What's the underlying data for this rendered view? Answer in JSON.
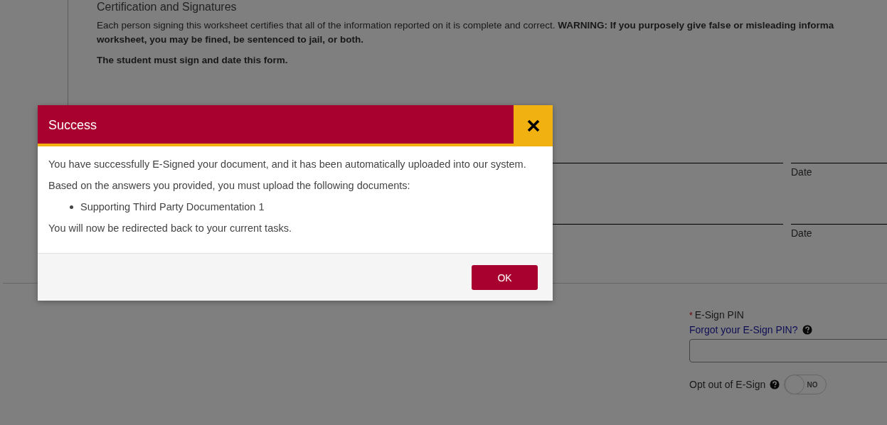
{
  "page": {
    "section_title": "Certification and Signatures",
    "certification_lines": [
      "Each person signing this worksheet certifies that all of the information reported on it is complete and correct. **WARNING: If you purposely give false or misleading informa**",
      "**worksheet, you may be fined, be sentenced to jail, or both.**"
    ],
    "student_note": "The student must sign and date this form.",
    "signature_rows": [
      {
        "date_label": "Date"
      },
      {
        "date_label": "Date"
      }
    ],
    "esign": {
      "required_mark": "*",
      "label": "E-Sign PIN",
      "help_link": "Forgot your E-Sign PIN?",
      "opt_out": {
        "label": "Opt out of E-Sign",
        "on": false,
        "state_text": "NO"
      }
    }
  },
  "modal": {
    "title": "Success",
    "message": "You have successfully E-Signed your document, and it has been automatically uploaded into our system.",
    "intro": "Based on the answers you provided, you must upload the following documents:",
    "documents": [
      "Supporting Third Party Documentation 1"
    ],
    "closing": "You will now be redirected back to your current tasks.",
    "buttons": [
      "OK"
    ]
  }
}
